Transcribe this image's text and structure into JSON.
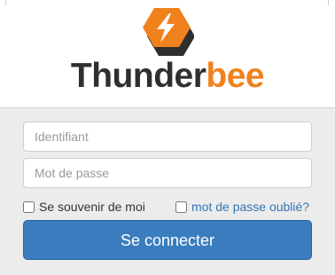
{
  "brand": {
    "name_dark": "Thunder",
    "name_accent": "bee",
    "logo_icon": "lightning-hexagon-icon",
    "colors": {
      "dark": "#2f2f2f",
      "accent": "#f0821e",
      "hexagon_front": "#f0821e",
      "hexagon_back": "#2f2f2f"
    }
  },
  "login": {
    "username_placeholder": "Identifiant",
    "password_placeholder": "Mot de passe",
    "remember_label": "Se souvenir de moi",
    "forgot_label": "mot de passe oublié?",
    "submit_label": "Se connecter",
    "colors": {
      "button": "#3a7dbf",
      "link": "#3375b3"
    }
  }
}
